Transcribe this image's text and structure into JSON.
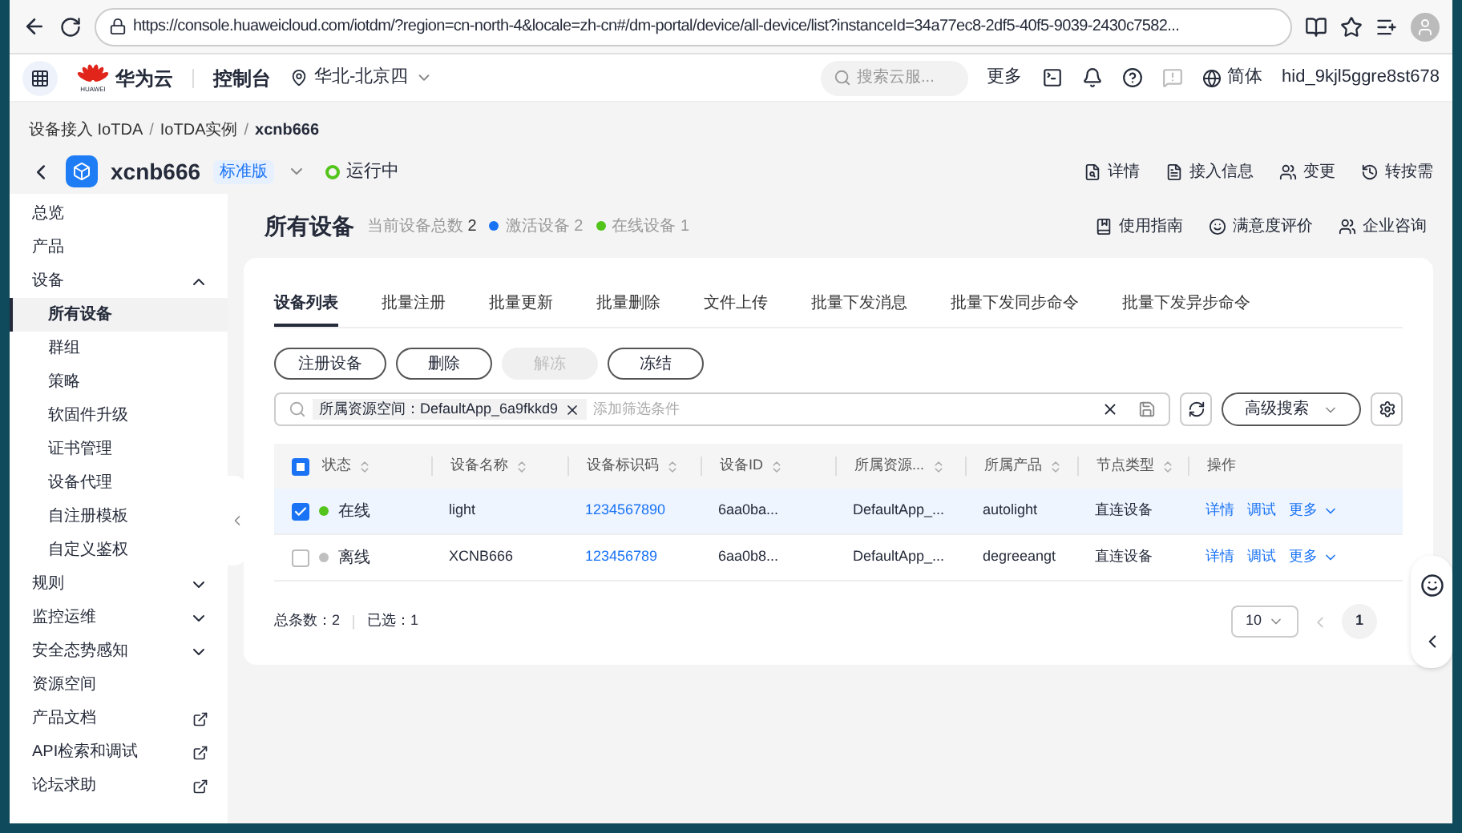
{
  "browser": {
    "url": "https://console.huaweicloud.com/iotdm/?region=cn-north-4&locale=zh-cn#/dm-portal/device/all-device/list?instanceId=34a77ec8-2df5-40f5-9039-2430c7582..."
  },
  "topnav": {
    "brand": "华为云",
    "brand_sub": "HUAWEI",
    "console": "控制台",
    "region": "华北-北京四",
    "search": {
      "placeholder": "搜索云服..."
    },
    "more": "更多",
    "language": "简体",
    "user": "hid_9kjl5ggre8st678"
  },
  "breadcrumb": {
    "separator": "/",
    "items": [
      {
        "label": "设备接入 IoTDA",
        "current": false
      },
      {
        "label": "IoTDA实例",
        "current": false
      },
      {
        "label": "xcnb666",
        "current": true
      }
    ]
  },
  "instance": {
    "name": "xcnb666",
    "edition": "标准版",
    "status": "运行中",
    "actions": [
      "详情",
      "接入信息",
      "变更",
      "转按需"
    ]
  },
  "sidebar": [
    {
      "label": "总览",
      "kind": "link"
    },
    {
      "label": "产品",
      "kind": "link"
    },
    {
      "label": "设备",
      "kind": "group",
      "expanded": true,
      "children": [
        {
          "label": "所有设备",
          "selected": true
        },
        {
          "label": "群组",
          "selected": false
        },
        {
          "label": "策略",
          "selected": false
        },
        {
          "label": "软固件升级",
          "selected": false
        },
        {
          "label": "证书管理",
          "selected": false
        },
        {
          "label": "设备代理",
          "selected": false
        },
        {
          "label": "自注册模板",
          "selected": false
        },
        {
          "label": "自定义鉴权",
          "selected": false
        }
      ]
    },
    {
      "label": "规则",
      "kind": "group",
      "expanded": false
    },
    {
      "label": "监控运维",
      "kind": "group",
      "expanded": false
    },
    {
      "label": "安全态势感知",
      "kind": "group",
      "expanded": false
    },
    {
      "label": "资源空间",
      "kind": "link"
    },
    {
      "label": "产品文档",
      "kind": "external"
    },
    {
      "label": "API检索和调试",
      "kind": "external"
    },
    {
      "label": "论坛求助",
      "kind": "external"
    }
  ],
  "page": {
    "title": "所有设备",
    "total_label": "当前设备总数",
    "total": "2",
    "stats": [
      {
        "label": "激活设备 2",
        "color": "#1a73f5"
      },
      {
        "label": "在线设备 1",
        "color": "#52c41a"
      }
    ],
    "links": [
      "使用指南",
      "满意度评价",
      "企业咨询"
    ]
  },
  "tabs": [
    {
      "label": "设备列表",
      "selected": true
    },
    {
      "label": "批量注册",
      "selected": false
    },
    {
      "label": "批量更新",
      "selected": false
    },
    {
      "label": "批量删除",
      "selected": false
    },
    {
      "label": "文件上传",
      "selected": false
    },
    {
      "label": "批量下发消息",
      "selected": false
    },
    {
      "label": "批量下发同步命令",
      "selected": false
    },
    {
      "label": "批量下发异步命令",
      "selected": false
    }
  ],
  "buttons": [
    {
      "label": "注册设备",
      "disabled": false
    },
    {
      "label": "删除",
      "disabled": false
    },
    {
      "label": "解冻",
      "disabled": true
    },
    {
      "label": "冻结",
      "disabled": false
    }
  ],
  "filter": {
    "tag": "所属资源空间：DefaultApp_6a9fkkd9",
    "placeholder": "添加筛选条件",
    "advanced": "高级搜索"
  },
  "table": {
    "select_all": {
      "indeterminate": true
    },
    "columns": [
      {
        "label": "状态",
        "sortable": true
      },
      {
        "label": "设备名称",
        "sortable": true
      },
      {
        "label": "设备标识码",
        "sortable": true
      },
      {
        "label": "设备ID",
        "sortable": true
      },
      {
        "label": "所属资源...",
        "sortable": true
      },
      {
        "label": "所属产品",
        "sortable": true
      },
      {
        "label": "节点类型",
        "sortable": true
      },
      {
        "label": "操作",
        "sortable": false
      }
    ],
    "rows": [
      {
        "selected": true,
        "status": "在线",
        "color": "#52c41a",
        "name": "light",
        "code": "1234567890",
        "id": "6aa0ba...",
        "space": "DefaultApp_...",
        "product": "autolight",
        "node": "直连设备",
        "actions": [
          "详情",
          "调试",
          "更多"
        ]
      },
      {
        "selected": false,
        "status": "离线",
        "color": "#c0c0c0",
        "name": "XCNB666",
        "code": "123456789",
        "id": "6aa0b8...",
        "space": "DefaultApp_...",
        "product": "degreeangt",
        "node": "直连设备",
        "actions": [
          "详情",
          "调试",
          "更多"
        ]
      }
    ]
  },
  "footer": {
    "total": "总条数：2",
    "selected": "已选：1",
    "page_size": "10",
    "page": "1"
  }
}
